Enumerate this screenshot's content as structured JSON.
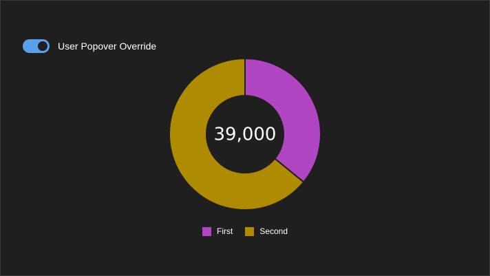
{
  "toggle": {
    "label": "User Popover Override",
    "on": true,
    "color": "#5aa0ea"
  },
  "chart_data": {
    "type": "pie",
    "donut": true,
    "center_label": "39,000",
    "series": [
      {
        "name": "First",
        "value": 14000,
        "color": "#b146c2"
      },
      {
        "name": "Second",
        "value": 25000,
        "color": "#ae8b00"
      }
    ],
    "legend_position": "bottom"
  }
}
